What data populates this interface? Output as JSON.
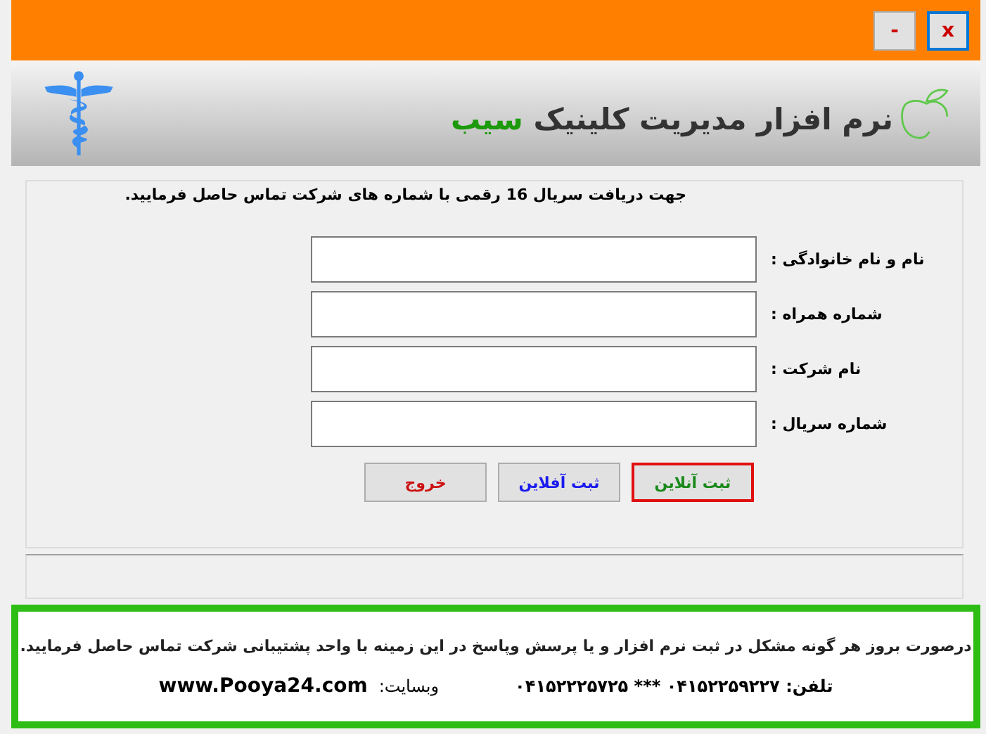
{
  "title_bar": {
    "minimize": "-",
    "close": "x"
  },
  "header": {
    "title": "نرم افزار مدیریت کلینیک",
    "title_accent": "سیب"
  },
  "form": {
    "instruction": "جهت دریافت سریال 16 رقمی با شماره های شرکت تماس حاصل فرمایید.",
    "fields": [
      {
        "label": "نام و نام خانوادگی :"
      },
      {
        "label": "شماره همراه :"
      },
      {
        "label": "نام شرکت :"
      },
      {
        "label": "شماره سریال :"
      }
    ],
    "buttons": [
      {
        "label": "ثبت آنلاین",
        "color": "#1a8a1a",
        "selected": true
      },
      {
        "label": "ثبت آفلاین",
        "color": "#1a1aee",
        "selected": false
      },
      {
        "label": "خروج",
        "color": "#cc1111",
        "selected": false
      }
    ]
  },
  "support": {
    "message": "درصورت بروز هر گونه مشکل در ثبت نرم افزار و یا  پرسش وپاسخ در این زمینه با واحد پشتیبانی شرکت تماس حاصل فرمایید.",
    "phones": "تلفن: ۰۴۱۵۲۲۵۹۲۲۷ *** ۰۴۱۵۲۲۲۵۷۲۵",
    "website_label": "وبسایت:",
    "website": "www.Pooya24.com"
  }
}
